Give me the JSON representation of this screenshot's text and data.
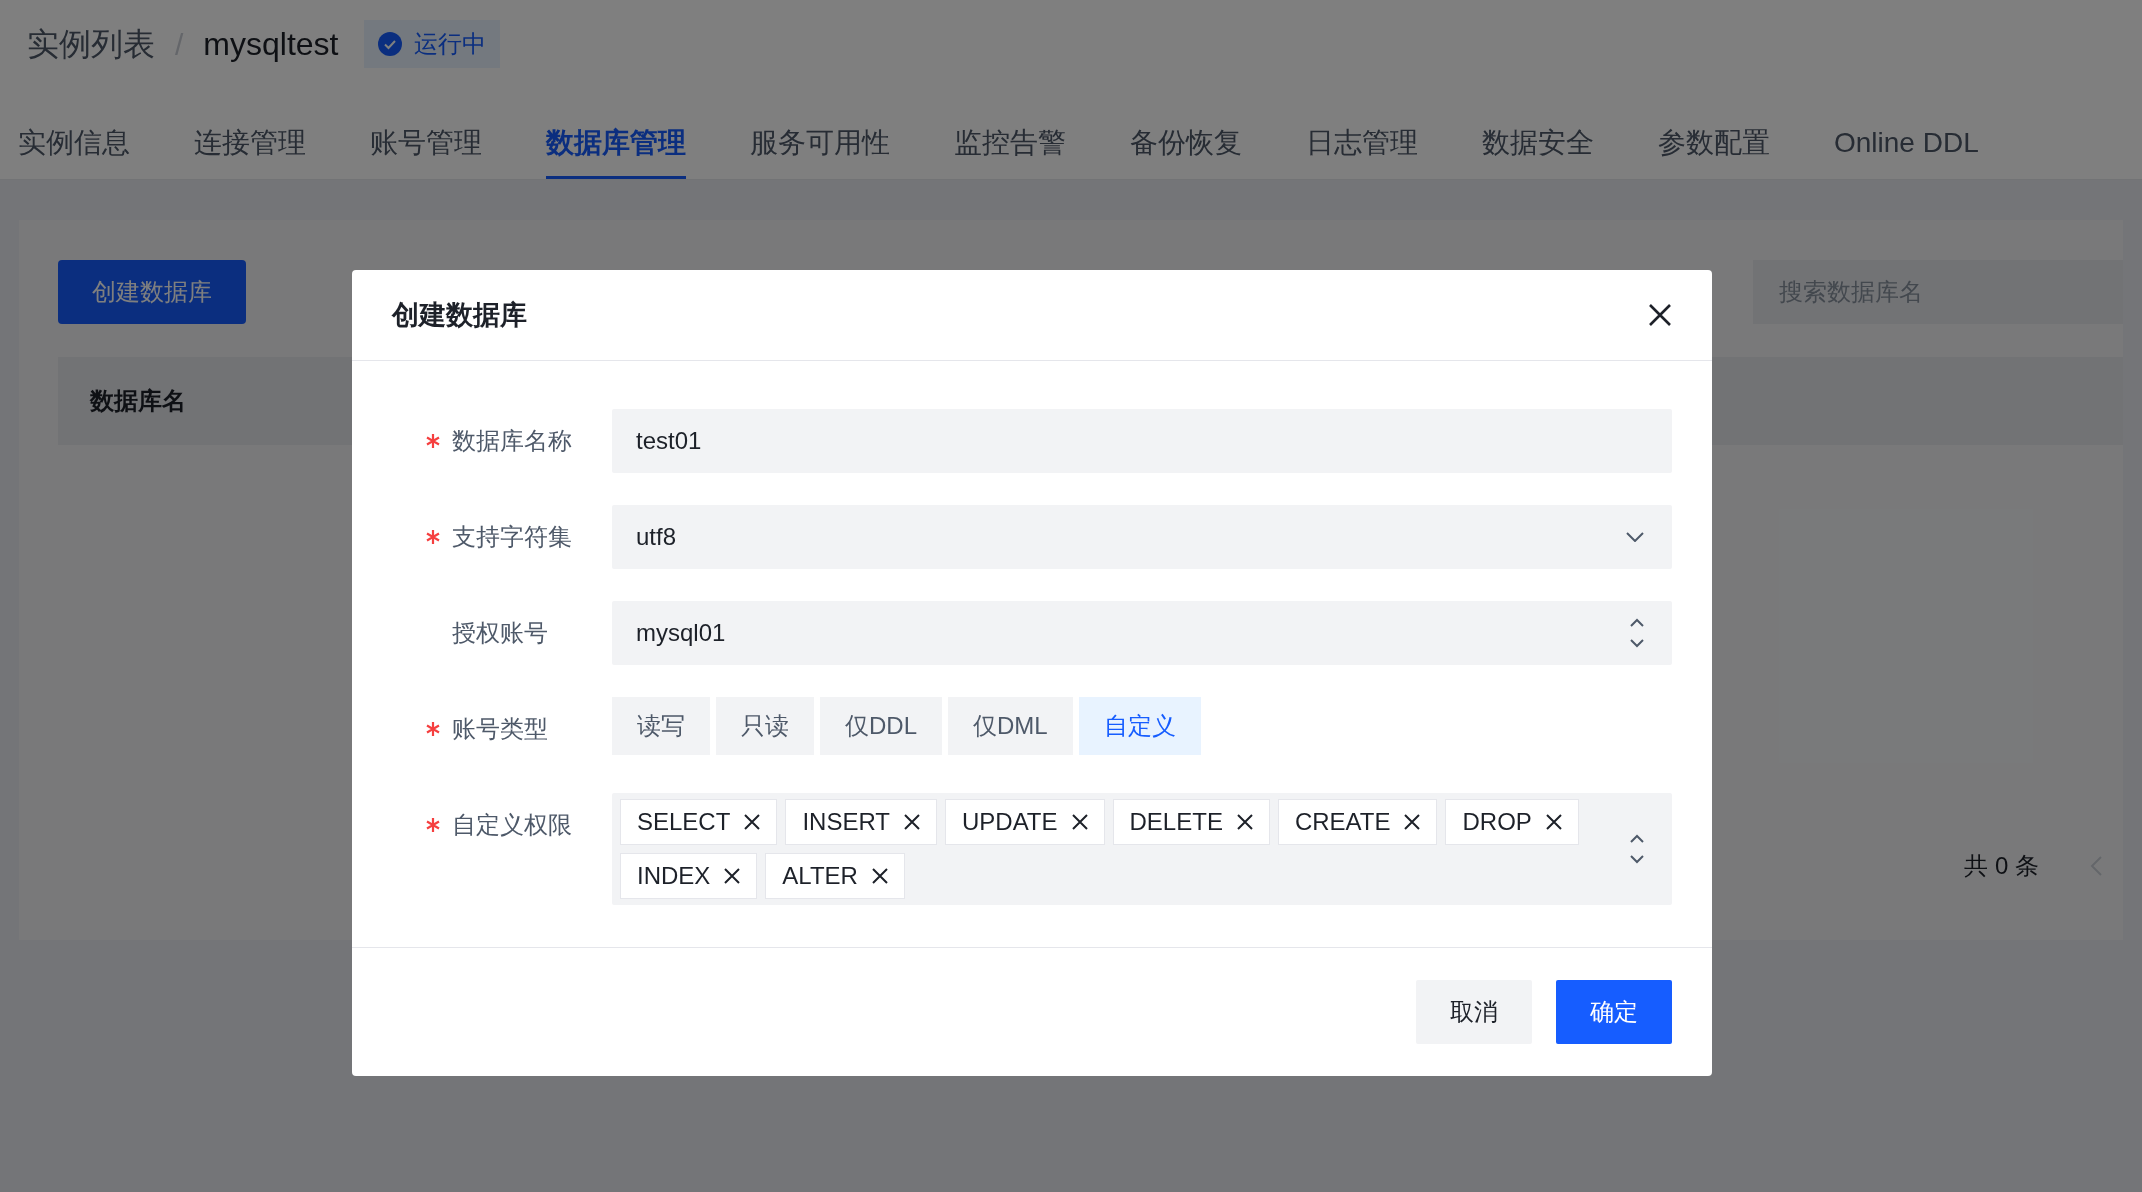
{
  "breadcrumb": {
    "items": [
      "实例列表",
      "mysqltest"
    ],
    "separator": "/",
    "status": "运行中"
  },
  "tabs": [
    {
      "label": "实例信息",
      "selected": false
    },
    {
      "label": "连接管理",
      "selected": false
    },
    {
      "label": "账号管理",
      "selected": false
    },
    {
      "label": "数据库管理",
      "selected": true
    },
    {
      "label": "服务可用性",
      "selected": false
    },
    {
      "label": "监控告警",
      "selected": false
    },
    {
      "label": "备份恢复",
      "selected": false
    },
    {
      "label": "日志管理",
      "selected": false
    },
    {
      "label": "数据安全",
      "selected": false
    },
    {
      "label": "参数配置",
      "selected": false
    },
    {
      "label": "Online DDL",
      "selected": false
    }
  ],
  "toolbar": {
    "create_button": "创建数据库",
    "search": {
      "placeholder": "搜索数据库名"
    }
  },
  "table": {
    "columns": [
      "数据库名"
    ],
    "total": "共 0 条"
  },
  "modal": {
    "title": "创建数据库",
    "fields": [
      {
        "kind": "input",
        "label": "数据库名称",
        "required": true,
        "value": "test01"
      },
      {
        "kind": "select",
        "label": "支持字符集",
        "required": true,
        "value": "utf8"
      },
      {
        "kind": "combobox",
        "label": "授权账号",
        "required": false,
        "value": "mysql01"
      },
      {
        "kind": "segmented",
        "label": "账号类型",
        "required": true,
        "options": [
          {
            "label": "读写",
            "selected": false
          },
          {
            "label": "只读",
            "selected": false
          },
          {
            "label": "仅DDL",
            "selected": false
          },
          {
            "label": "仅DML",
            "selected": false
          },
          {
            "label": "自定义",
            "selected": true
          }
        ]
      },
      {
        "kind": "tags",
        "label": "自定义权限",
        "required": true,
        "tags": [
          "SELECT",
          "INSERT",
          "UPDATE",
          "DELETE",
          "CREATE",
          "DROP",
          "INDEX",
          "ALTER"
        ]
      }
    ],
    "buttons": [
      {
        "label": "取消",
        "kind": "default"
      },
      {
        "label": "确定",
        "kind": "primary"
      }
    ]
  }
}
